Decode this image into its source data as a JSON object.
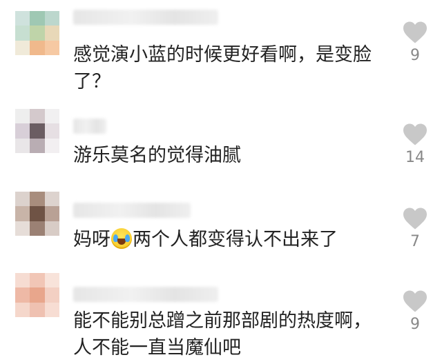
{
  "comments": [
    {
      "text": "感觉演小蓝的时候更好看啊，是变脸了？",
      "line1": "感觉演小蓝的时候更好看啊，是变脸",
      "line2": "了？",
      "likes": "9",
      "avatar_colors": [
        "#cfe2dd",
        "#9fc8b3",
        "#bcd7cd",
        "#c7dfd1",
        "#bfd4a9",
        "#e8d8b8",
        "#f0ead9",
        "#f0b98c",
        "#f6c9a3"
      ]
    },
    {
      "text": "游乐莫名的觉得油腻",
      "likes": "14",
      "avatar_colors": [
        "#eeeeee",
        "#d4c9cc",
        "#f1f0f1",
        "#d8cfd8",
        "#6b5d62",
        "#e6dfe3",
        "#e9e6e8",
        "#b9adb3",
        "#f2eff1"
      ]
    },
    {
      "text_before": "妈呀",
      "text_after": "两个人都变得认不出来了",
      "likes": "7",
      "avatar_colors": [
        "#dcd2cd",
        "#a88d7d",
        "#ddd3ce",
        "#c8b4a8",
        "#6f5345",
        "#b9a195",
        "#e6ddd8",
        "#9b8174",
        "#d8ccc6"
      ]
    },
    {
      "text": "能不能别总蹭之前那部剧的热度啊，人不能一直当魔仙吧",
      "line1": "能不能别总蹭之前那部剧的热度啊，",
      "line2": "人不能一直当魔仙吧",
      "likes": "9",
      "avatar_colors": [
        "#f6dcd2",
        "#f1c6b6",
        "#f8e3da",
        "#eeb9a6",
        "#e8a68c",
        "#f3d0c3",
        "#f5d7cb",
        "#efc1b1",
        "#f7ddd3"
      ]
    }
  ],
  "icons": {
    "like": "heart-icon",
    "emoji": "laughing-crying-emoji"
  },
  "colors": {
    "heart": "#c8c8c8",
    "text": "#222222",
    "count": "#888888"
  }
}
